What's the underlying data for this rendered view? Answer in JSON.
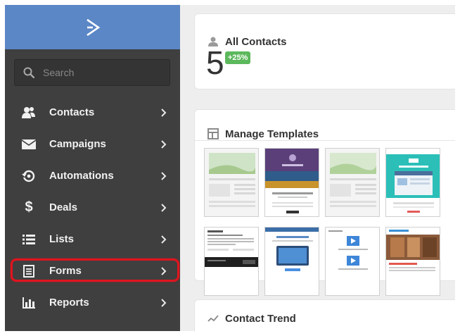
{
  "sidebar": {
    "search_placeholder": "Search",
    "items": [
      {
        "label": "Contacts",
        "icon": "contacts-icon"
      },
      {
        "label": "Campaigns",
        "icon": "envelope-icon"
      },
      {
        "label": "Automations",
        "icon": "automation-icon"
      },
      {
        "label": "Deals",
        "icon": "dollar-icon"
      },
      {
        "label": "Lists",
        "icon": "list-icon"
      },
      {
        "label": "Forms",
        "icon": "form-icon",
        "highlighted": true
      },
      {
        "label": "Reports",
        "icon": "bar-chart-icon"
      }
    ]
  },
  "contacts_card": {
    "title": "All Contacts",
    "count": "5",
    "change": "+25%"
  },
  "templates_card": {
    "title": "Manage Templates"
  },
  "trend_card": {
    "title": "Contact Trend"
  },
  "colors": {
    "brand": "#5b87c6",
    "sidebar": "#3f3f3f",
    "badge": "#5cb85c",
    "highlight": "#e0141e"
  }
}
